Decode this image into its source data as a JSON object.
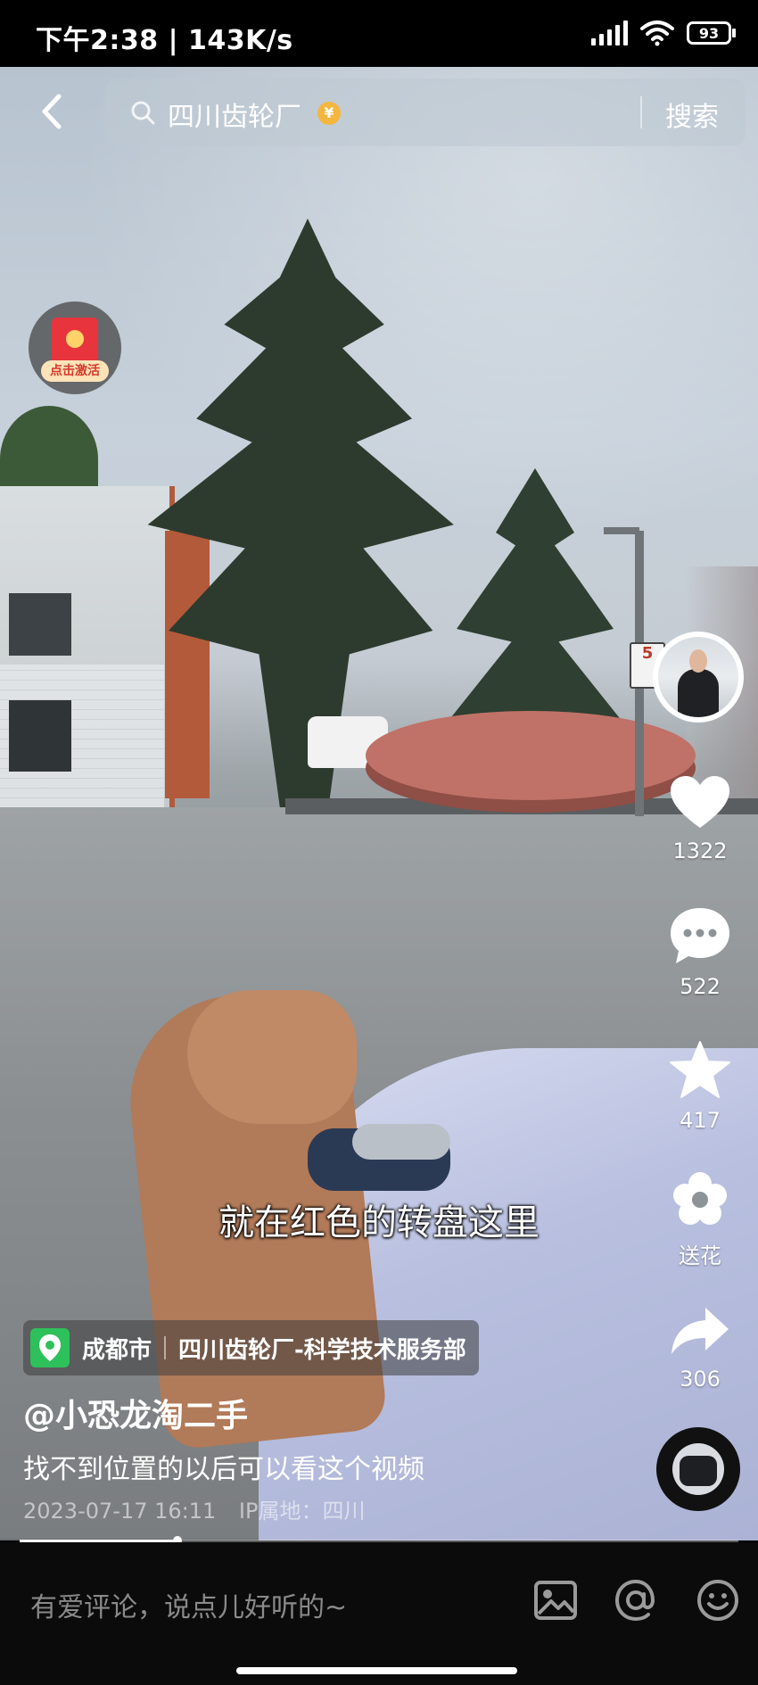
{
  "status_bar": {
    "time_speed": "下午2:38 | 143K/s",
    "battery": "93"
  },
  "search": {
    "query": "四川齿轮厂",
    "coin_symbol": "¥",
    "button": "搜索"
  },
  "red_packet": {
    "label": "点击激活"
  },
  "subtitle": "就在红色的转盘这里",
  "actions": {
    "likes": "1322",
    "comments": "522",
    "favorites": "417",
    "flower": "送花",
    "shares": "306"
  },
  "location": {
    "city": "成都市",
    "place": "四川齿轮厂-科学技术服务部"
  },
  "post": {
    "author": "@小恐龙淘二手",
    "description": "找不到位置的以后可以看这个视频",
    "datetime": "2023-07-17 16:11",
    "ip": "IP属地：四川"
  },
  "playback": {
    "progress": 0.22
  },
  "comment_bar": {
    "placeholder": "有爱评论，说点儿好听的~"
  },
  "colors": {
    "location_pin": "#2ec05a",
    "coin": "#f4b63e"
  }
}
